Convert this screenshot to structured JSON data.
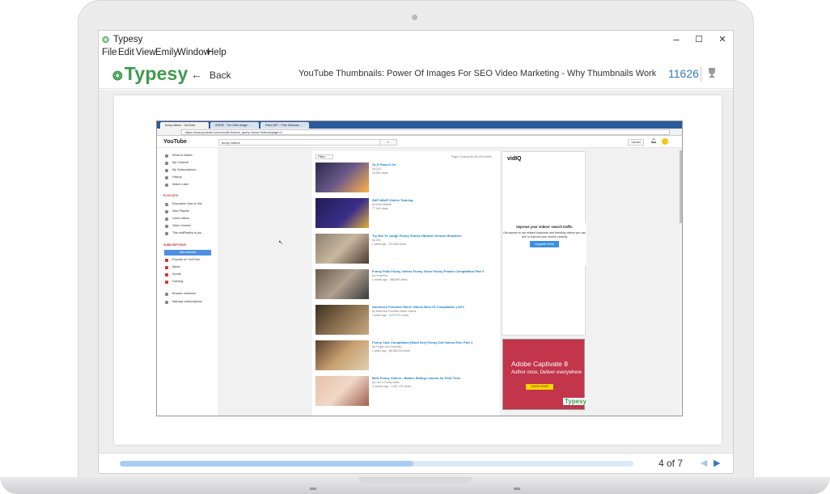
{
  "window": {
    "title": "Typesy",
    "controls": {
      "minimize": "–",
      "maximize": "☐",
      "close": "✕"
    }
  },
  "menu": [
    "File",
    "Edit",
    "View",
    "Emily",
    "Window",
    "Help"
  ],
  "header": {
    "brand": "Typesy",
    "back_label": "Back",
    "lesson_title": "YouTube Thumbnails: Power Of Images For SEO Video Marketing - Why Thumbnails Work",
    "score": "11626",
    "icons": [
      "back-arrow-icon",
      "trophy-icon"
    ]
  },
  "footer": {
    "progress_fraction": 4,
    "progress_total": 7,
    "page_label": "4 of 7"
  },
  "colors": {
    "brand_green": "#3d9b4b",
    "accent_blue": "#3478c4",
    "progress_track": "#dbe9f6",
    "progress_fill": "#a8cdf0"
  },
  "slide": {
    "browser": {
      "tabs": [
        "funny videos - YouTube",
        "IDRAP - The Ultra Image ...",
        "Paint.NET - Free Software ..."
      ],
      "url": "https://www.youtube.com/results?search_query=funny+videos&page=4"
    },
    "youtube": {
      "logo": "YouTube",
      "search_query": "funny videos",
      "upload_label": "Upload",
      "guide": [
        "What to Watch",
        "My Channel",
        "My Subscriptions",
        "History",
        "Watch Later"
      ],
      "playlists_heading": "PLAYLISTS",
      "playlists": [
        "Education How to Vid...",
        "New Playlist",
        "Liked videos",
        "Video Games",
        "This widPlaylist is jus..."
      ],
      "subscriptions_heading": "SUBSCRIPTIONS",
      "add_channels_label": "Add channels",
      "subscriptions": [
        "Popular on YouTube",
        "Music",
        "Sports",
        "Gaming"
      ],
      "bottom_links": [
        "Browse channels",
        "Manage subscriptions"
      ],
      "filters_label": "Filters",
      "result_count": "Page 4 of about 38,400,000 results",
      "videos": [
        {
          "title": "OLG Pass It On",
          "channel": "by OLG",
          "meta": "43,544 views"
        },
        {
          "title": "SAP ABAP Online Training",
          "channel": "by Kiran Basetti",
          "meta": "77,144 views"
        },
        {
          "title": "Try Not To Laugh Funny Videos Hardest Version Reaction!",
          "channel": "by Jinx",
          "meta": "1 week ago · 231,683 views"
        },
        {
          "title": "Funny Fails Funny Videos Funny Vines Funny Pranks Compilation Part 3",
          "channel": "by HomeFun",
          "meta": "1 month ago · 368,699 views"
        },
        {
          "title": "America's Funniest Home Videos Best Of Compilation | AFV",
          "channel": "by America's Funniest Home Videos",
          "meta": "2 years ago · 5,207,071 views"
        },
        {
          "title": "Funny Cats Compilation [Most See] Funny Cat Videos Ever Part 1",
          "channel": "by Forget Your Sadness",
          "meta": "2 years ago · 88,268,034 views"
        },
        {
          "title": "Best Funny Videos - Babies Eating Lemons for First Time",
          "channel": "by I am a Funny Video",
          "meta": "3 months ago · 3,287,371 views"
        }
      ],
      "vidiq": {
        "logo": "vidIQ",
        "overlay_title": "Improve your videos' search traffic",
        "overlay_text": "Get access to top related keywords and trending videos you can use to improve your search ranking",
        "button": "Upgrade Now!"
      },
      "ad": {
        "title": "Adobe Captivate 8",
        "subtitle": "Author once, Deliver everywhere",
        "button": "LEARN MORE",
        "watermark": "Typesy"
      }
    }
  }
}
